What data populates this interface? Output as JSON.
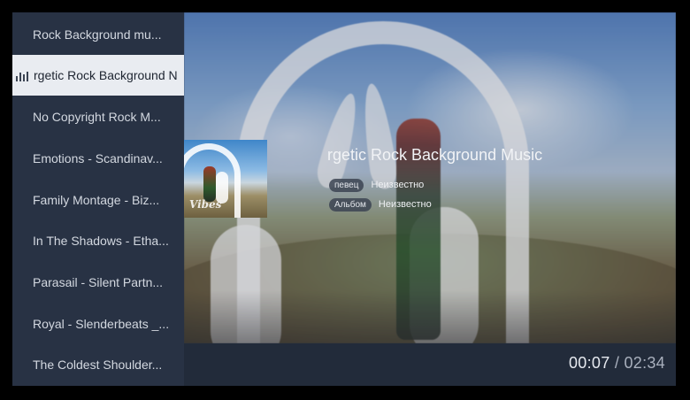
{
  "playlist": [
    {
      "label": "Rock Background mu..."
    },
    {
      "label": "rgetic Rock Background N",
      "active": true
    },
    {
      "label": "No Copyright Rock M..."
    },
    {
      "label": "Emotions - Scandinav..."
    },
    {
      "label": "Family Montage - Biz..."
    },
    {
      "label": "In The Shadows - Etha..."
    },
    {
      "label": "Parasail - Silent Partn..."
    },
    {
      "label": "Royal - Slenderbeats _..."
    },
    {
      "label": "The Coldest Shoulder..."
    }
  ],
  "now_playing": {
    "title": "rgetic Rock Background Music",
    "artist_tag": "певец",
    "artist_value": "Неизвестно",
    "album_tag": "Альбом",
    "album_value": "Неизвестно",
    "thumbnail_text": "Vibes"
  },
  "playback": {
    "current_time": "00:07",
    "separator": "/",
    "total_time": "02:34"
  },
  "icons": {
    "active_indicator": "equalizer-bars-icon"
  },
  "colors": {
    "sidebar_bg": "#283244",
    "active_item_bg": "#e9ecf1",
    "bottom_bar_bg": "#222b3a"
  }
}
